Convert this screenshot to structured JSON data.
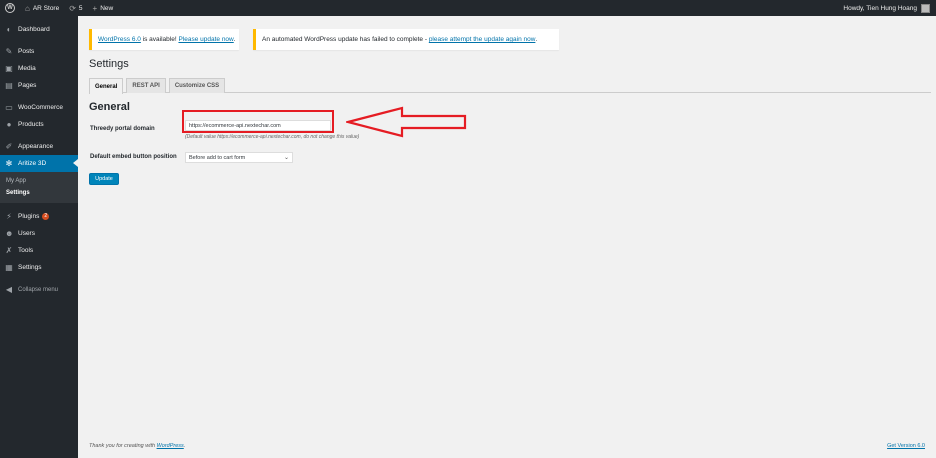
{
  "adminbar": {
    "site_name": "AR Store",
    "updates_count": "5",
    "new_label": "New",
    "greeting": "Howdy, Tien Hung Hoang"
  },
  "sidebar": {
    "items": [
      {
        "label": "Dashboard",
        "icon": "dashboard-icon"
      },
      {
        "label": "Posts",
        "icon": "pin-icon"
      },
      {
        "label": "Media",
        "icon": "media-icon"
      },
      {
        "label": "Pages",
        "icon": "page-icon"
      },
      {
        "label": "WooCommerce",
        "icon": "woo-icon"
      },
      {
        "label": "Products",
        "icon": "products-icon"
      },
      {
        "label": "Appearance",
        "icon": "brush-icon"
      },
      {
        "label": "Aritize 3D",
        "icon": "gear-icon"
      },
      {
        "label": "Plugins",
        "icon": "plug-icon",
        "badge": "2"
      },
      {
        "label": "Users",
        "icon": "user-icon"
      },
      {
        "label": "Tools",
        "icon": "wrench-icon"
      },
      {
        "label": "Settings",
        "icon": "settings-icon"
      }
    ],
    "submenu": [
      {
        "label": "My App"
      },
      {
        "label": "Settings"
      }
    ],
    "collapse_label": "Collapse menu"
  },
  "notices": {
    "update_link": "WordPress 6.0",
    "update_mid": " is available! ",
    "update_action": "Please update now",
    "update_end": ".",
    "failed_text": "An automated WordPress update has failed to complete - ",
    "failed_link": "please attempt the update again now",
    "failed_end": "."
  },
  "page": {
    "title": "Settings",
    "tabs": [
      {
        "label": "General"
      },
      {
        "label": "REST API"
      },
      {
        "label": "Customize CSS"
      }
    ],
    "section_title": "General",
    "domain_label": "Threedy portal domain",
    "domain_value": "https://ecommerce-api.nextechar.com",
    "domain_hint": "(Default value https://ecommerce-api.nextechar.com, do not change this value)",
    "embed_label": "Default embed button position",
    "embed_value": "Before add to cart form",
    "update_button": "Update"
  },
  "footer": {
    "thanks_prefix": "Thank you for creating with ",
    "thanks_link": "WordPress",
    "thanks_end": ".",
    "version": "Get Version 6.0"
  },
  "colors": {
    "accent": "#0073aa",
    "annotation": "#e51c23",
    "notice_border": "#ffb900"
  }
}
